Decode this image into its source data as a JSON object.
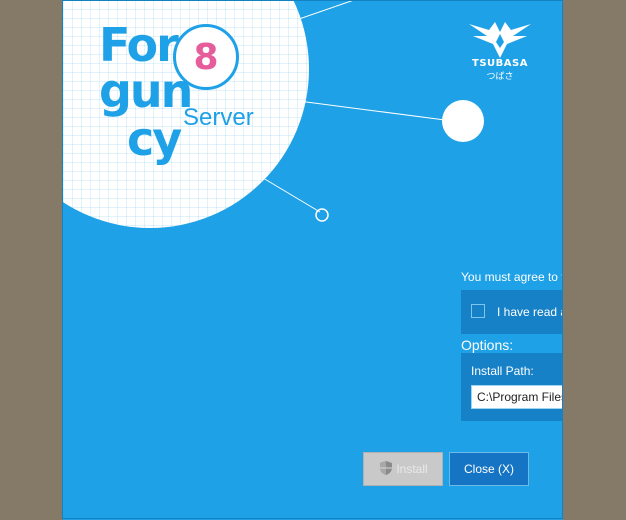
{
  "logo": {
    "line1": "For",
    "line2": "gun",
    "line3": "cy",
    "version": "8",
    "edition": "Server"
  },
  "brand": {
    "name": "TSUBASA",
    "subtitle": "つばさ"
  },
  "agreement": {
    "prompt": "You must agree to t",
    "checkbox_label": "I have read a",
    "checked": false
  },
  "options": {
    "title": "Options:",
    "install_path_label": "Install Path:",
    "install_path_value": "C:\\Program Files"
  },
  "buttons": {
    "install": "Install",
    "close": "Close (X)"
  },
  "colors": {
    "background": "#1ea1e6",
    "panel": "#1681c7",
    "accent_pink": "#e65d9b",
    "desktop": "#847a67"
  }
}
